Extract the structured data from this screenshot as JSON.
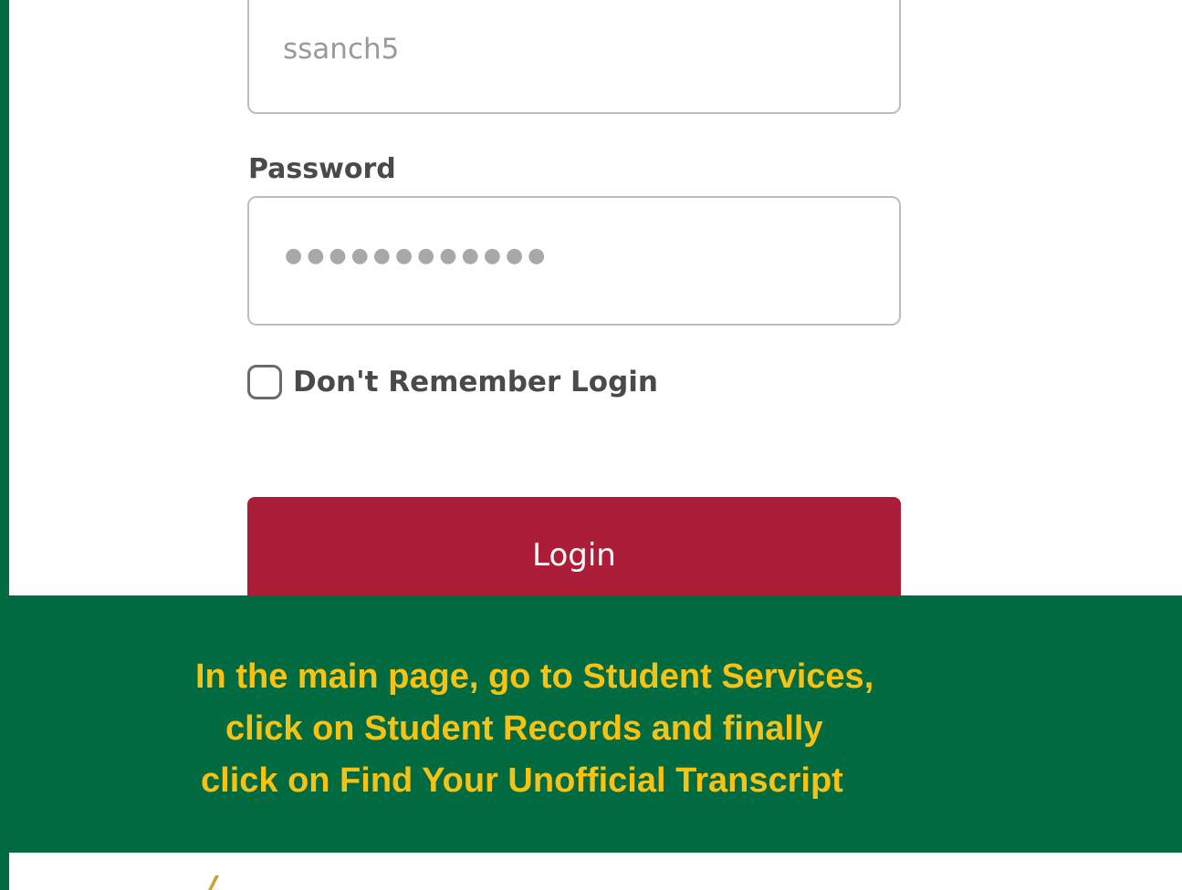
{
  "login_form": {
    "username_value": "ssanch5",
    "password_label": "Password",
    "password_mask": "●●●●●●●●●●●●",
    "remember_label": "Don't Remember Login",
    "remember_checked": false,
    "login_button_label": "Login"
  },
  "instructions": {
    "line1": "In the main page, go to Student Services,",
    "line2": "click on Student Records and finally",
    "line3": "click on Find Your Unofficial Transcript"
  },
  "colors": {
    "brand_green": "#006b40",
    "login_button": "#ac1d37",
    "instruction_text": "#f7c214"
  },
  "icons": {
    "logo_fragment": "logo-fragment-icon"
  }
}
